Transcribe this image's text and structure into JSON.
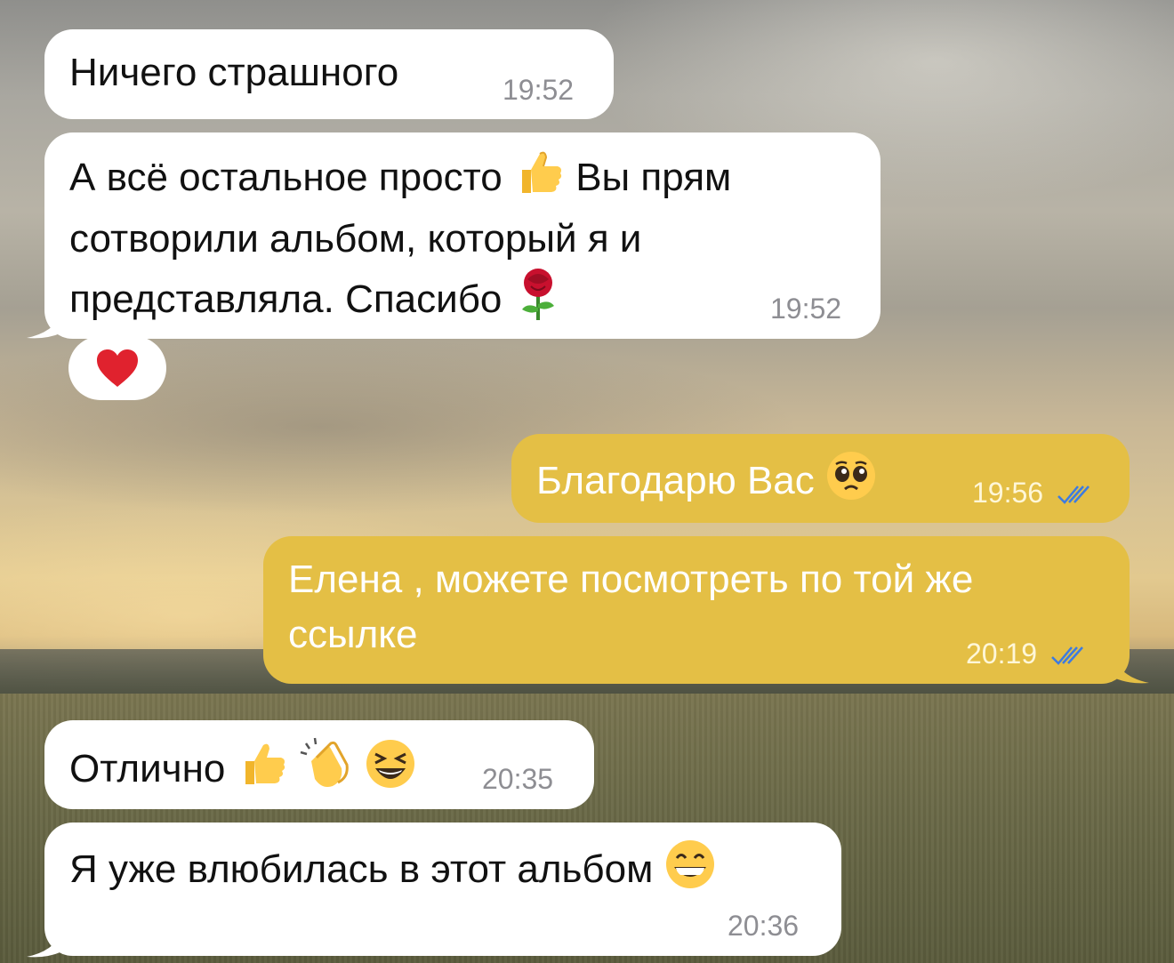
{
  "messages": [
    {
      "direction": "incoming",
      "text": "Ничего страшного",
      "time": "19:52"
    },
    {
      "direction": "incoming",
      "line1": "А всё остальное просто",
      "line1_end": "Вы прям",
      "line2": "сотворили альбом, который я и",
      "line3": "представляла. Спасибо",
      "emojis": [
        "thumbs-up",
        "rose"
      ],
      "time": "19:52",
      "reaction": "heart"
    },
    {
      "direction": "outgoing",
      "text": "Благодарю Вас",
      "emoji": "pleading-face",
      "time": "19:56",
      "status": "read"
    },
    {
      "direction": "outgoing",
      "line1": "Елена , можете посмотреть по той же",
      "line2": "ссылке",
      "time": "20:19",
      "status": "read"
    },
    {
      "direction": "incoming",
      "text": "Отлично",
      "emojis": [
        "thumbs-up",
        "clapping-hands",
        "grinning-squinting-face"
      ],
      "time": "20:35"
    },
    {
      "direction": "incoming",
      "text": "Я уже влюбилась в этот альбом",
      "emoji": "beaming-face",
      "time": "20:36"
    }
  ],
  "colors": {
    "incoming_bubble": "#ffffff",
    "outgoing_bubble": "#e4bf45",
    "read_checks": "#3d7be0"
  }
}
